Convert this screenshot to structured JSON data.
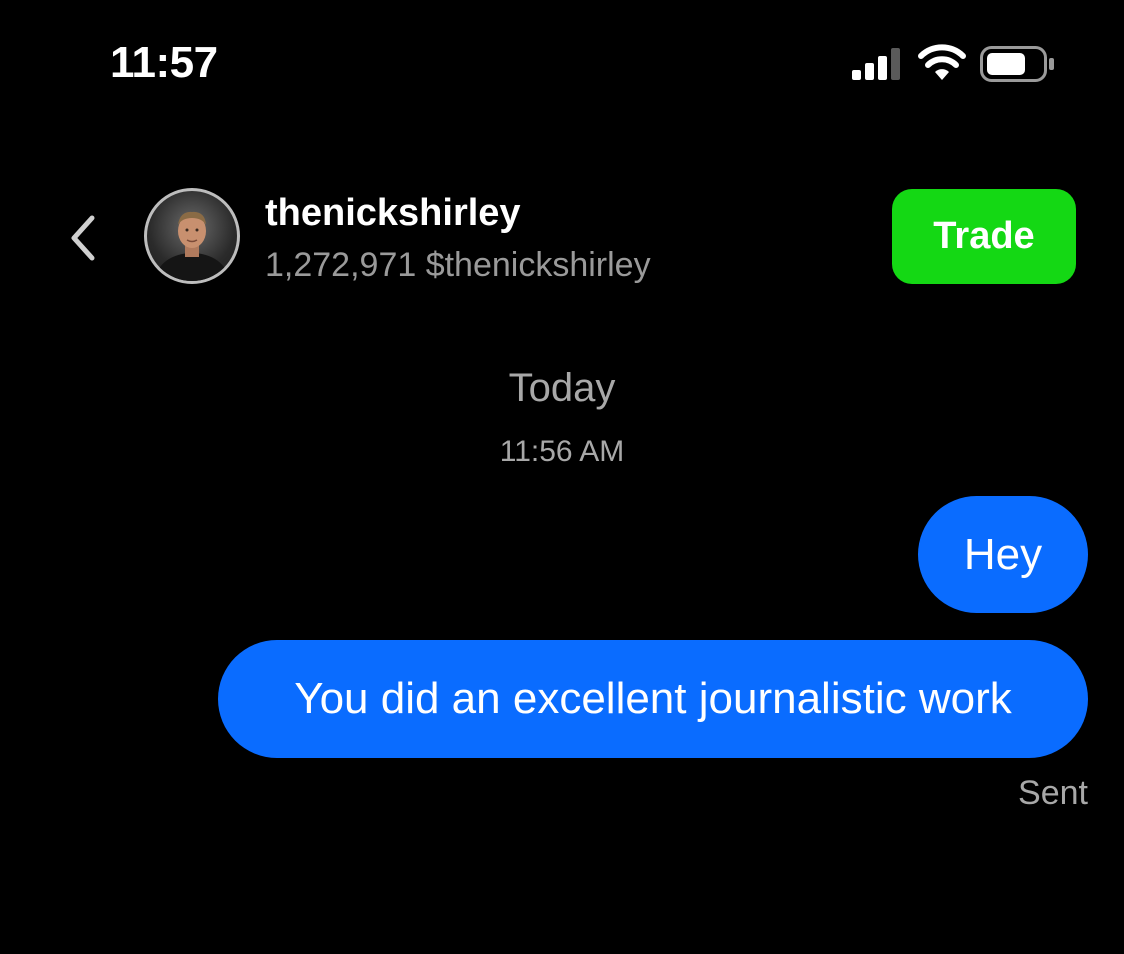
{
  "status_bar": {
    "time": "11:57",
    "icons": [
      "signal-icon",
      "wifi-icon",
      "battery-icon"
    ]
  },
  "header": {
    "back_icon": "chevron-left-icon",
    "avatar": "avatar",
    "name": "thenickshirley",
    "subtitle": "1,272,971 $thenickshirley",
    "trade_label": "Trade",
    "trade_color": "#14d814"
  },
  "conversation": {
    "date": "Today",
    "time": "11:56 AM",
    "messages": [
      {
        "text": "Hey",
        "from": "me"
      },
      {
        "text": "You did an excellent journalistic work",
        "from": "me"
      }
    ],
    "status": "Sent",
    "bubble_color": "#0a6cff"
  }
}
